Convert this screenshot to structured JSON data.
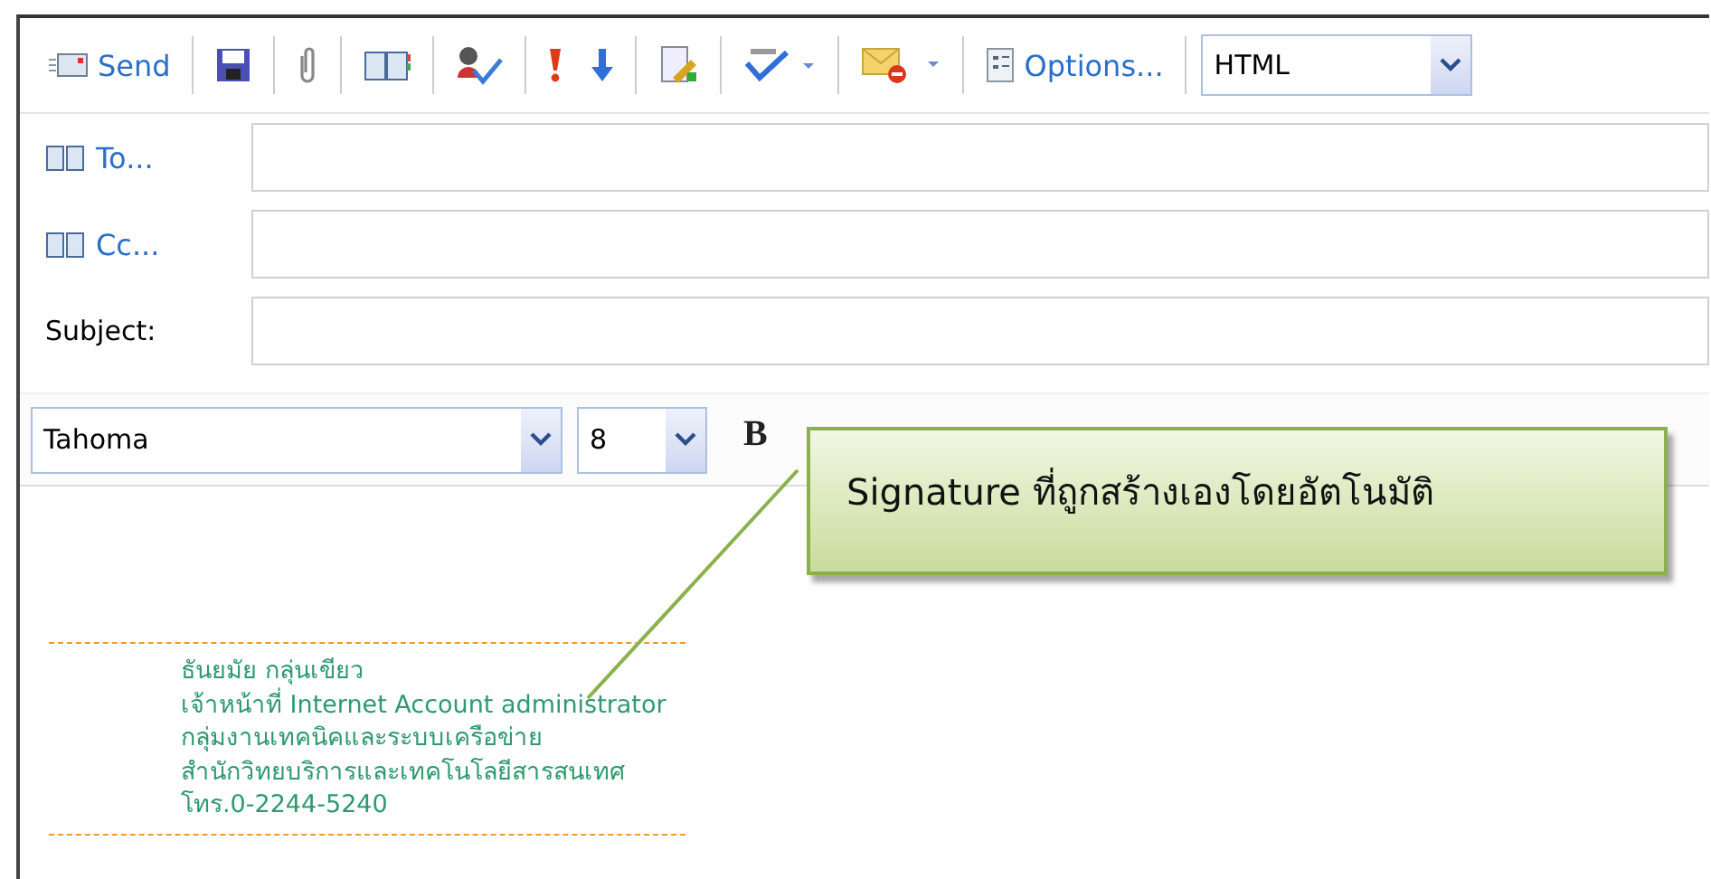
{
  "toolbar": {
    "send_label": "Send",
    "options_label": "Options...",
    "format": "HTML"
  },
  "recipients": [
    {
      "kind": "address",
      "label": "To..."
    },
    {
      "kind": "address",
      "label": "Cc..."
    },
    {
      "kind": "plain",
      "label": "Subject:"
    }
  ],
  "formatting": {
    "font": "Tahoma",
    "size": "8",
    "styles": [
      "B"
    ]
  },
  "callout": {
    "text": "Signature ที่ถูกสร้างเองโดยอัตโนมัติ"
  },
  "signature": {
    "lines": [
      "ธันยมัย กลุ่นเขียว",
      "เจ้าหน้าที่ Internet Account administrator",
      "กลุ่มงานเทคนิคและระบบเครือข่าย",
      "สำนักวิทยบริการและเทคโนโลยีสารสนเทศ",
      "โทร.0-2244-5240"
    ]
  }
}
